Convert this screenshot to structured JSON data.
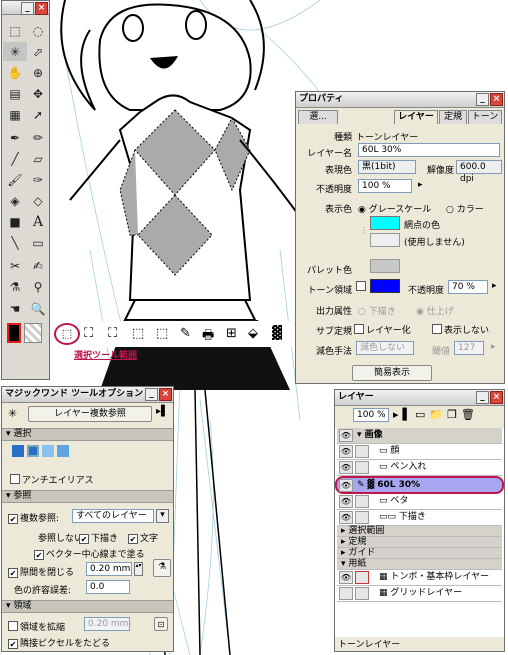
{
  "toolbox": {
    "tools": [
      "marquee-rect",
      "lasso",
      "magic-wand",
      "selection-pen",
      "move",
      "layer-move",
      "zoom",
      "hand",
      "object-select",
      "text",
      "pen",
      "eraser",
      "marker",
      "brush",
      "fill",
      "gradient",
      "ruler",
      "dropper",
      "gray-square"
    ]
  },
  "caption": "選択ツール範囲",
  "selection_bar": {
    "tools": [
      "lasso-wand-tool",
      "rect-select",
      "expand",
      "shrink",
      "border",
      "clear",
      "fill",
      "invert",
      "transform",
      "pen-convert",
      "tone"
    ]
  },
  "magic": {
    "title": "マジックワンド ツールオプション",
    "mode_label": "レイヤー複数参照",
    "sec_select": "選択",
    "anti_alias": "アンチエイリアス",
    "sec_ref": "参照",
    "multi_ref_label": "複数参照:",
    "multi_ref_value": "すべてのレイヤー",
    "no_ref_label": "参照しない",
    "draft": "下描き",
    "text": "文字",
    "vector": "ベクター中心線まで塗る",
    "close_gap": "隙間を閉じる",
    "gap_value": "0.20 mm",
    "tolerance_label": "色の許容誤差:",
    "tolerance_value": "0.0",
    "sec_area": "領域",
    "expand": "領域を拡縮",
    "expand_value": "0.20 mm",
    "adjacent": "隣接ピクセルをたどる"
  },
  "props": {
    "title": "プロパティ",
    "tabs": [
      "選...",
      "レイヤー",
      "定規",
      "トーン"
    ],
    "kind_label": "種類",
    "kind_value": "トーンレイヤー",
    "name_label": "レイヤー名",
    "name_value": "60L 30%",
    "expr_label": "表現色",
    "expr_value": "黒(1bit)",
    "res_label": "解像度",
    "res_value": "600.0 dpi",
    "opacity_label": "不透明度",
    "opacity_value": "100 %",
    "color_label": "表示色",
    "gray": "グレースケール",
    "color": "カラー",
    "dot_color": "網点の色",
    "unused": "(使用しません)",
    "palette": "パレット色",
    "tone_area": "トーン領域",
    "tone_opacity_label": "不透明度",
    "tone_opacity_value": "70 %",
    "output": "出力属性",
    "draft": "下描き",
    "finish": "仕上げ",
    "sub_ruler": "サブ定規",
    "layer_ize": "レイヤー化",
    "hide": "表示しない",
    "reduce": "減色手法",
    "reduce_value": "減色しない",
    "threshold": "閾値",
    "threshold_value": "127",
    "simple": "簡易表示",
    "accent": "#00ffff",
    "area_color": "#0000ff"
  },
  "layers": {
    "title": "レイヤー",
    "zoom": "100 %",
    "items": [
      {
        "name": "画像",
        "group": true
      },
      {
        "name": "顔"
      },
      {
        "name": "ペン入れ"
      },
      {
        "name": "60L 30%",
        "selected": true
      },
      {
        "name": "ベタ"
      },
      {
        "name": "下描き"
      },
      {
        "name": "選択範囲",
        "group": true
      },
      {
        "name": "定規",
        "group": true
      },
      {
        "name": "ガイド",
        "group": true
      },
      {
        "name": "用紙",
        "group": true
      },
      {
        "name": "トンボ・基本枠レイヤー"
      },
      {
        "name": "グリッドレイヤー"
      }
    ],
    "status": "トーンレイヤー"
  }
}
